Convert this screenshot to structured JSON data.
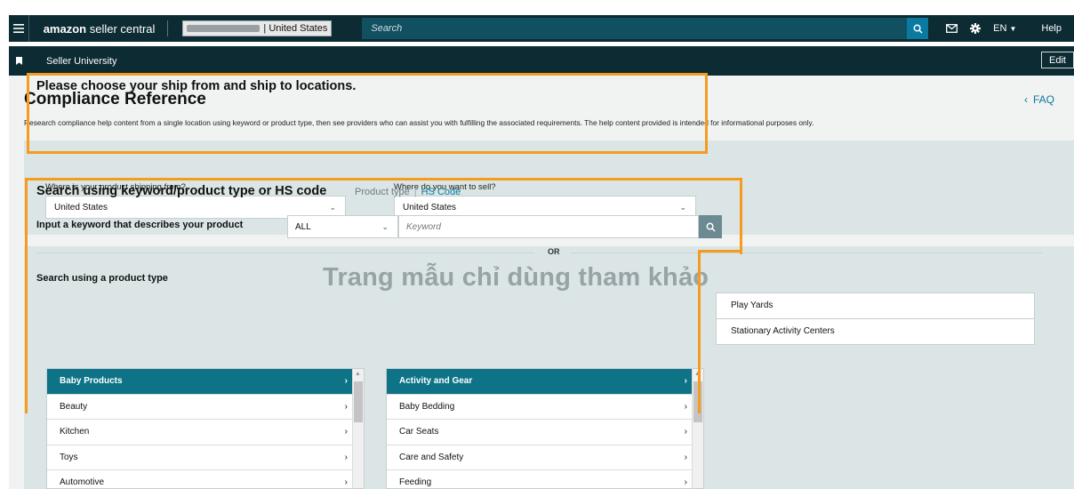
{
  "topbar": {
    "logo_brand": "amazon",
    "logo_text": " seller central",
    "account_suffix": "| United States",
    "search_placeholder": "Search",
    "lang": "EN",
    "help": "Help"
  },
  "subbar": {
    "title": "Seller University",
    "edit": "Edit"
  },
  "page": {
    "title": "Compliance Reference",
    "faq": "FAQ",
    "description": "Research compliance help content from a single location using keyword or product type, then see providers who can assist you with fulfilling the associated requirements. The help content provided is intended for informational purposes only."
  },
  "ship": {
    "title": "Please choose your ship from and ship to locations.",
    "from_label": "Where is your product shipping from?",
    "from_value": "United States",
    "to_label": "Where do you want to sell?",
    "to_value": "United States"
  },
  "search_kw": {
    "title": "Search using keyword/product type or HS code",
    "tab_product_type": "Product type",
    "tab_hs_code": "HS Code",
    "input_label": "Input a keyword that describes your product",
    "category_value": "ALL",
    "keyword_placeholder": "Keyword",
    "or": "OR"
  },
  "product_type": {
    "title": "Search using a product type",
    "watermark": "Trang mẫu chỉ dùng tham khảo",
    "col1": [
      "Baby Products",
      "Beauty",
      "Kitchen",
      "Toys",
      "Automotive"
    ],
    "col2": [
      "Activity and Gear",
      "Baby Bedding",
      "Car Seats",
      "Care and Safety",
      "Feeding"
    ],
    "col3": [
      "Play Yards",
      "Stationary Activity Centers"
    ]
  },
  "colors": {
    "nav_bg": "#0c2b33",
    "accent": "#0e7387",
    "highlight": "#f59b1e",
    "panel_bg": "#dbe5e5"
  }
}
